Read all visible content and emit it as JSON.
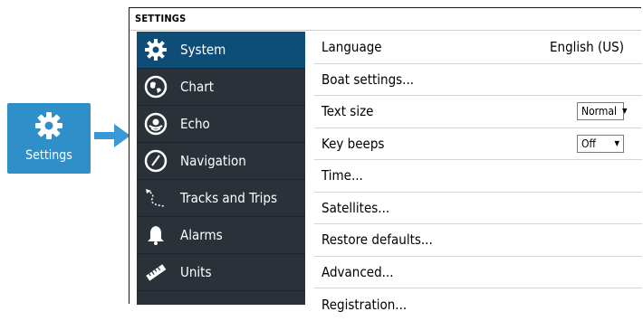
{
  "launcher": {
    "label": "Settings",
    "icon": "gear-icon",
    "color": "#2f8fc9"
  },
  "window": {
    "title": "SETTINGS"
  },
  "sidebar": {
    "items": [
      {
        "label": "System",
        "icon": "gear-icon",
        "active": true
      },
      {
        "label": "Chart",
        "icon": "chart-icon",
        "active": false
      },
      {
        "label": "Echo",
        "icon": "echo-icon",
        "active": false
      },
      {
        "label": "Navigation",
        "icon": "compass-icon",
        "active": false
      },
      {
        "label": "Tracks and Trips",
        "icon": "tracks-icon",
        "active": false
      },
      {
        "label": "Alarms",
        "icon": "bell-icon",
        "active": false
      },
      {
        "label": "Units",
        "icon": "ruler-icon",
        "active": false
      }
    ]
  },
  "system": {
    "rows": [
      {
        "label": "Language",
        "value": "English (US)"
      },
      {
        "label": "Boat settings..."
      },
      {
        "label": "Text size",
        "dropdown": "Normal"
      },
      {
        "label": "Key beeps",
        "dropdown": "Off"
      },
      {
        "label": "Time..."
      },
      {
        "label": "Satellites..."
      },
      {
        "label": "Restore defaults..."
      },
      {
        "label": "Advanced..."
      },
      {
        "label": "Registration..."
      }
    ]
  },
  "colors": {
    "sidebar_bg": "#2a3138",
    "sidebar_active": "#0d4d77",
    "accent": "#2f8fc9"
  }
}
